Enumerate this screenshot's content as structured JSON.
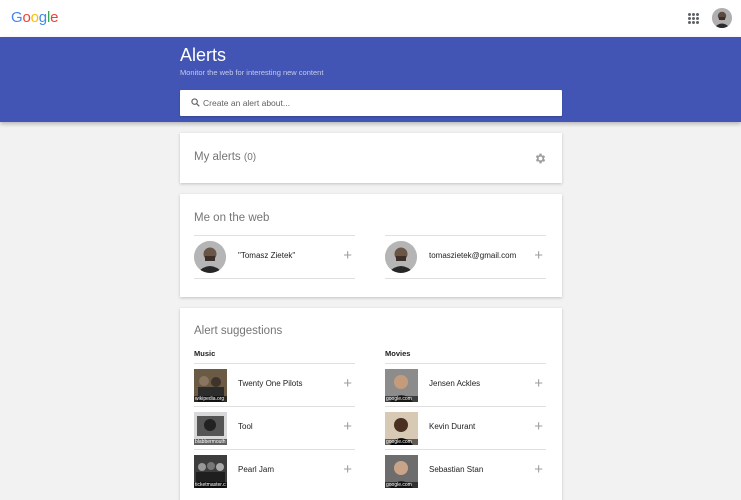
{
  "app": {
    "logo": "Google"
  },
  "colors": {
    "header": "#4255b5",
    "logo_blue": "#4285f4",
    "logo_red": "#ea4335",
    "logo_yellow": "#fbbc05",
    "logo_green": "#34a853"
  },
  "header": {
    "title": "Alerts",
    "subtitle": "Monitor the web for interesting new content",
    "search_placeholder": "Create an alert about..."
  },
  "my_alerts": {
    "title": "My alerts",
    "count": "(0)"
  },
  "me_on_web": {
    "title": "Me on the web",
    "items": [
      {
        "label": "\"Tomasz Zietek\""
      },
      {
        "label": "tomaszietek@gmail.com"
      }
    ]
  },
  "suggestions": {
    "title": "Alert suggestions",
    "music": {
      "heading": "Music",
      "items": [
        {
          "label": "Twenty One Pilots",
          "source": "wikipedia.org"
        },
        {
          "label": "Tool",
          "source": "blabbermouth"
        },
        {
          "label": "Pearl Jam",
          "source": "ticketmaster.c"
        }
      ]
    },
    "movies": {
      "heading": "Movies",
      "items": [
        {
          "label": "Jensen Ackles",
          "source": "google.com"
        },
        {
          "label": "Kevin Durant",
          "source": "google.com"
        },
        {
          "label": "Sebastian Stan",
          "source": "google.com"
        }
      ]
    }
  },
  "icons": {
    "plus": "+",
    "gear": "gear-icon",
    "apps": "apps-grid-icon",
    "search": "search-icon"
  }
}
